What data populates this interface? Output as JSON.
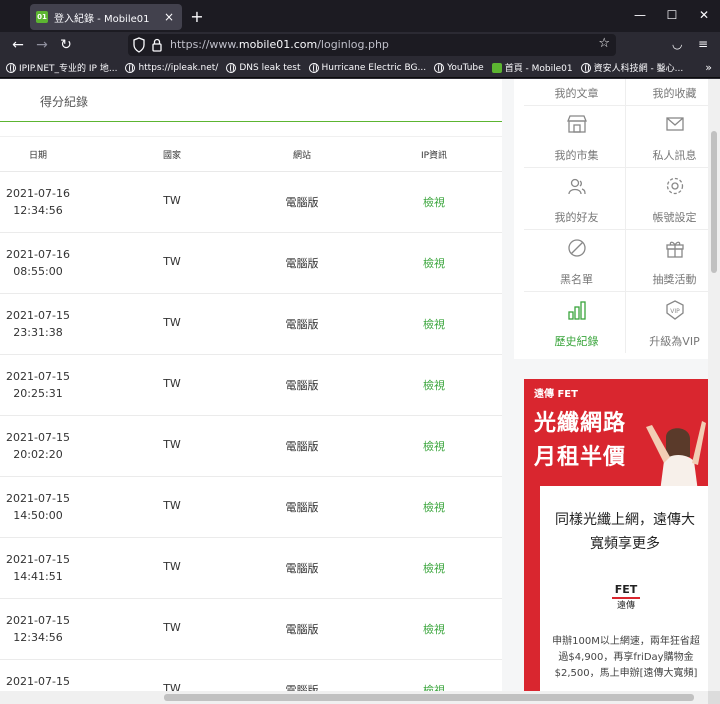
{
  "browser": {
    "tab_title": "登入紀錄 - Mobile01",
    "tab_favicon": "01",
    "url_prefix": "https://www.",
    "url_host": "mobile01.com",
    "url_path": "/loginlog.php",
    "bookmarks": [
      {
        "label": "IPIP.NET_专业的 IP 地...",
        "icon": "globe"
      },
      {
        "label": "https://ipleak.net/",
        "icon": "globe"
      },
      {
        "label": "DNS leak test",
        "icon": "globe"
      },
      {
        "label": "Hurricane Electric BG...",
        "icon": "globe"
      },
      {
        "label": "YouTube",
        "icon": "globe"
      },
      {
        "label": "首頁 - Mobile01",
        "icon": "mobile01"
      },
      {
        "label": "資安人科技網 - 鑿心...",
        "icon": "globe"
      }
    ]
  },
  "main": {
    "section_title": "得分紀錄",
    "columns": [
      "日期",
      "國家",
      "網站",
      "IP資訊"
    ],
    "rows": [
      {
        "date": "2021-07-16",
        "time": "12:34:56",
        "country": "TW",
        "site": "電腦版",
        "ip": "檢視"
      },
      {
        "date": "2021-07-16",
        "time": "08:55:00",
        "country": "TW",
        "site": "電腦版",
        "ip": "檢視"
      },
      {
        "date": "2021-07-15",
        "time": "23:31:38",
        "country": "TW",
        "site": "電腦版",
        "ip": "檢視"
      },
      {
        "date": "2021-07-15",
        "time": "20:25:31",
        "country": "TW",
        "site": "電腦版",
        "ip": "檢視"
      },
      {
        "date": "2021-07-15",
        "time": "20:02:20",
        "country": "TW",
        "site": "電腦版",
        "ip": "檢視"
      },
      {
        "date": "2021-07-15",
        "time": "14:50:00",
        "country": "TW",
        "site": "電腦版",
        "ip": "檢視"
      },
      {
        "date": "2021-07-15",
        "time": "14:41:51",
        "country": "TW",
        "site": "電腦版",
        "ip": "檢視"
      },
      {
        "date": "2021-07-15",
        "time": "12:34:56",
        "country": "TW",
        "site": "電腦版",
        "ip": "檢視"
      },
      {
        "date": "2021-07-15",
        "time": "",
        "country": "TW",
        "site": "電腦版",
        "ip": "檢視"
      }
    ]
  },
  "sidebar": {
    "menu": [
      {
        "label": "我的文章",
        "icon": "article-icon"
      },
      {
        "label": "我的收藏",
        "icon": "favorite-icon"
      },
      {
        "label": "我的市集",
        "icon": "shop-icon"
      },
      {
        "label": "私人訊息",
        "icon": "mail-icon"
      },
      {
        "label": "我的好友",
        "icon": "friends-icon"
      },
      {
        "label": "帳號設定",
        "icon": "gear-icon"
      },
      {
        "label": "黑名單",
        "icon": "block-icon"
      },
      {
        "label": "抽獎活動",
        "icon": "gift-icon"
      },
      {
        "label": "歷史紀錄",
        "icon": "chart-icon",
        "active": true
      },
      {
        "label": "升級為VIP",
        "icon": "vip-icon"
      }
    ],
    "ad": {
      "brand": "遠傳 FET",
      "headline1": "光纖網路",
      "headline2": "月租半價",
      "card_head": "同樣光纖上網，遠傳大寬頻享更多",
      "logo_top": "FET",
      "logo_bottom": "遠傳",
      "card_body": "申辦100M以上網速，兩年狂省超過$4,900，再享friDay購物金$2,500，馬上申辦[遠傳大寬頻]"
    }
  },
  "colors": {
    "accent_green": "#3aa53c",
    "ad_red": "#d9262f"
  }
}
